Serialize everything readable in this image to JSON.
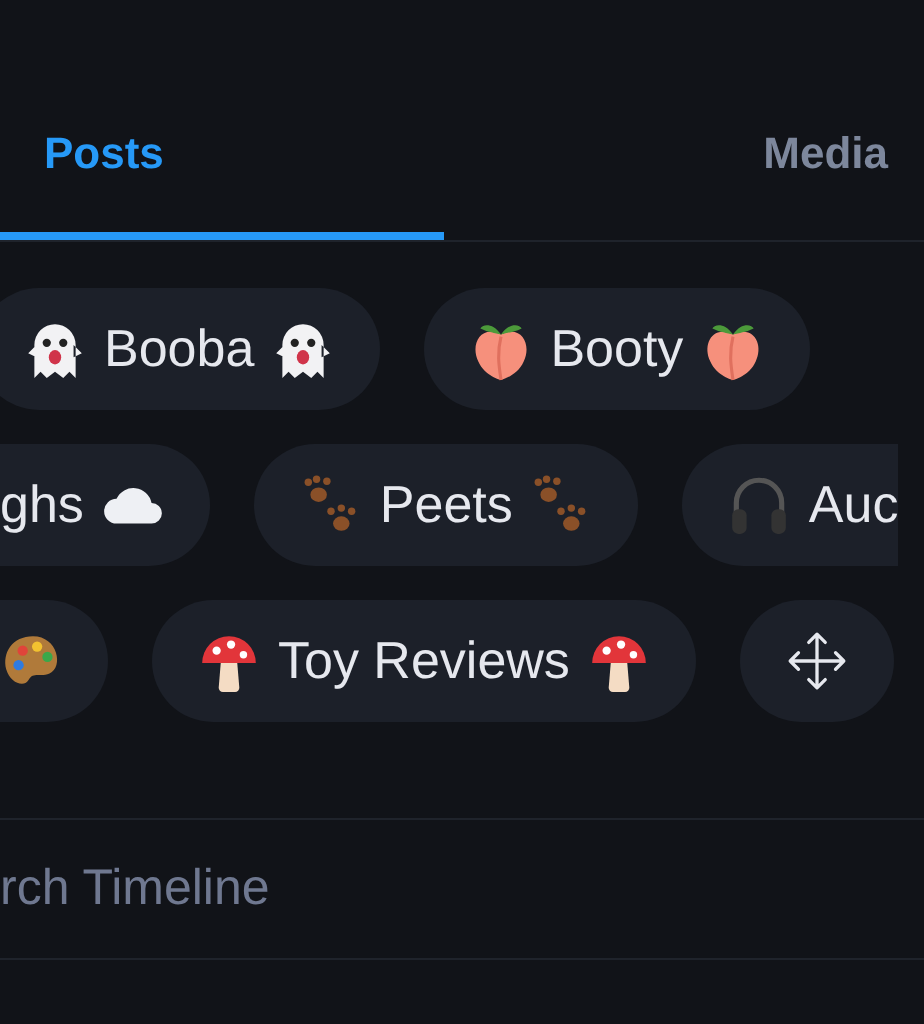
{
  "tabs": [
    {
      "label": "Posts",
      "selected": true
    },
    {
      "label": "Media",
      "selected": false
    }
  ],
  "tag_rows": [
    {
      "tags": [
        {
          "kind": "ghost",
          "label": "Booba"
        },
        {
          "kind": "peach",
          "label": "Booty"
        }
      ]
    },
    {
      "tags": [
        {
          "kind": "cloud",
          "label": "ghs",
          "cut_left": true
        },
        {
          "kind": "paw",
          "label": "Peets"
        },
        {
          "kind": "headphones",
          "label": "Auc",
          "cut_right": true
        }
      ]
    },
    {
      "tags": [
        {
          "kind": "palette",
          "cut_left": true
        },
        {
          "kind": "mushroom",
          "label": "Toy Reviews"
        },
        {
          "kind": "move"
        }
      ]
    }
  ],
  "search": {
    "placeholder": "rch Timeline"
  }
}
